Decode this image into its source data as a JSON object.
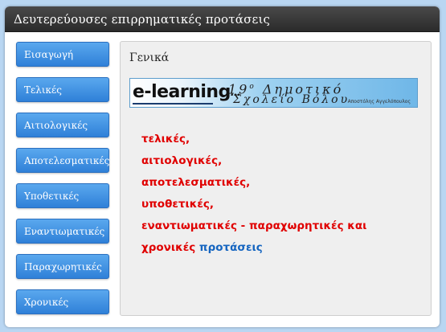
{
  "window": {
    "title": "Δευτερεύουσες επιρρηματικές προτάσεις"
  },
  "sidebar": {
    "items": [
      {
        "label": "Εισαγωγή"
      },
      {
        "label": "Τελικές"
      },
      {
        "label": "Αιτιολογικές"
      },
      {
        "label": "Αποτελεσματικές"
      },
      {
        "label": "Υποθετικές"
      },
      {
        "label": "Εναντιωματικές"
      },
      {
        "label": "Παραχωρητικές"
      },
      {
        "label": "Χρονικές"
      }
    ]
  },
  "main": {
    "title": "Γενικά",
    "banner": {
      "logo_e": "e-",
      "logo_learning": "learning",
      "logo_dots": "...",
      "school_number": "19",
      "school_sup": "ο",
      "school_line1_rest": " Δημοτικό",
      "school_line2": "Σχολείο Βόλου",
      "author": "Αποστόλης Αγγελόπουλος"
    },
    "topics": [
      "τελικές,",
      "αιτιολογικές,",
      "αποτελεσματικές,",
      "υποθετικές,"
    ],
    "topic_last_line1": "εναντιωματικές - παραχωρητικές και",
    "topic_last_line2_red": "χρονικές",
    "topic_last_line2_blue": "προτάσεις"
  },
  "colors": {
    "title_bar": "#333333",
    "nav_button": "#3f8fe2",
    "topic_red": "#e00000",
    "topic_blue": "#1565c0",
    "page_background": "#b9d6f2"
  }
}
